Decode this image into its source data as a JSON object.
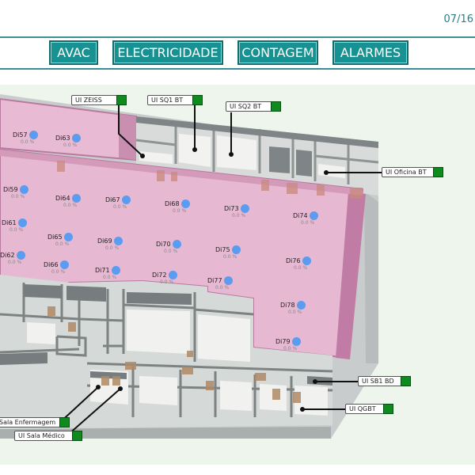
{
  "header": {
    "date": "07/16"
  },
  "nav": [
    {
      "label": "AVAC"
    },
    {
      "label": "ELECTRICIDADE"
    },
    {
      "label": "CONTAGEM"
    },
    {
      "label": "ALARMES"
    }
  ],
  "sensors": [
    {
      "label": "Di57",
      "value": "0.0 %"
    },
    {
      "label": "Di63",
      "value": "0.0 %"
    },
    {
      "label": "Di59",
      "value": "0.0 %"
    },
    {
      "label": "Di64",
      "value": "0.0 %"
    },
    {
      "label": "Di67",
      "value": "0.0 %"
    },
    {
      "label": "Di68",
      "value": "0.0 %"
    },
    {
      "label": "Di73",
      "value": "0.0 %"
    },
    {
      "label": "Di74",
      "value": "0.0 %"
    },
    {
      "label": "Di61",
      "value": "0.0 %"
    },
    {
      "label": "Di65",
      "value": "0.0 %"
    },
    {
      "label": "Di69",
      "value": "0.0 %"
    },
    {
      "label": "Di70",
      "value": "0.0 %"
    },
    {
      "label": "Di75",
      "value": "0.0 %"
    },
    {
      "label": "Di76",
      "value": "0.0 %"
    },
    {
      "label": "Di62",
      "value": "0.0 %"
    },
    {
      "label": "Di66",
      "value": "0.0 %"
    },
    {
      "label": "Di71",
      "value": "0.0 %"
    },
    {
      "label": "Di72",
      "value": "0.0 %"
    },
    {
      "label": "Di77",
      "value": "0.0 %"
    },
    {
      "label": "Di78",
      "value": "0.0 %"
    },
    {
      "label": "Di79",
      "value": "0.0 %"
    }
  ],
  "units": [
    {
      "label": "UI ZEISS"
    },
    {
      "label": "UI SQ1 BT"
    },
    {
      "label": "UI SQ2 BT"
    },
    {
      "label": "UI Oficina BT"
    },
    {
      "label": "UI SB1 BD"
    },
    {
      "label": "UI QGBT"
    },
    {
      "label": "Sala Enfermagem"
    },
    {
      "label": "UI Sala Médico"
    }
  ],
  "colors": {
    "accent": "#179191",
    "zone": "#e7b8d2",
    "sensor": "#5b9cf0",
    "unit_status": "#0e8a1e"
  }
}
